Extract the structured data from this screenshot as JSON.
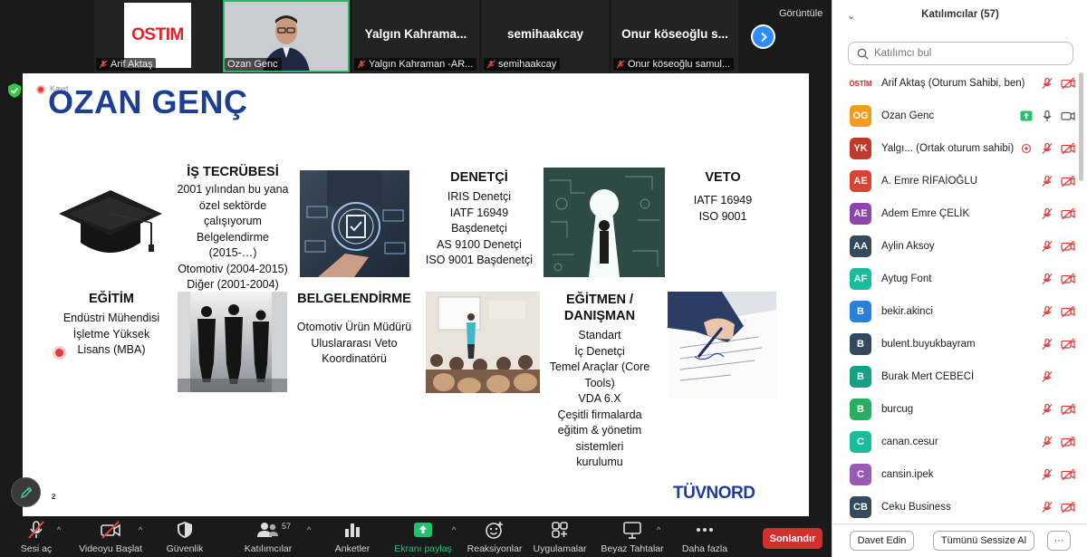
{
  "video_strip": {
    "tiles": [
      {
        "label": "Arif Aktaş",
        "logo_text": "OSTIM"
      },
      {
        "label": "Ozan Genc"
      },
      {
        "center_name": "Yalgın Kahrama...",
        "label": "Yalgın Kahraman -AR..."
      },
      {
        "center_name": "semihaakcay",
        "label": "semihaakcay"
      },
      {
        "center_name": "Onur köseoğlu s...",
        "label": "Onur köseoğlu samul..."
      }
    ],
    "view_label": "Görüntüle",
    "next_icon": "chevron-right-icon"
  },
  "slide": {
    "recording_label": "Kayıt",
    "title": "OZAN GENÇ",
    "sections": {
      "is_tecrubesi": {
        "heading": "İŞ TECRÜBESİ",
        "lines": [
          "2001 yılından bu yana",
          "özel sektörde",
          "çalışıyorum",
          "Belgelendirme",
          "(2015-…)",
          "Otomotiv  (2004-2015)",
          "Diğer (2001-2004)"
        ]
      },
      "denetci": {
        "heading": "DENETÇİ",
        "lines": [
          "IRIS Denetçi",
          "IATF 16949",
          "Başdenetçi",
          "AS 9100 Denetçi",
          "ISO 9001 Başdenetçi"
        ]
      },
      "veto": {
        "heading": "VETO",
        "lines": [
          "IATF 16949",
          "ISO 9001"
        ]
      },
      "egitim": {
        "heading": "EĞİTİM",
        "lines": [
          "Endüstri Mühendisi",
          "İşletme Yüksek",
          "Lisans (MBA)"
        ]
      },
      "belgelendirme": {
        "heading": "BELGELENDİRME",
        "lines": [
          "Otomotiv Ürün Müdürü",
          "Uluslararası Veto",
          "Koordinatörü"
        ]
      },
      "egitmen": {
        "heading_1": "EĞİTMEN /",
        "heading_2": "DANIŞMAN",
        "lines": [
          "Standart",
          "İç Denetçi",
          "Temel Araçlar (Core",
          "Tools)",
          "VDA 6.X",
          "Çeşitli firmalarda",
          "eğitim & yönetim",
          "sistemleri",
          "kurulumu"
        ]
      }
    },
    "page_number": "2",
    "logo_text": "TÜVNORD"
  },
  "toolbar": {
    "items": [
      {
        "label": "Sesi aç",
        "icon": "mic-muted-icon"
      },
      {
        "label": "Videoyu Başlat",
        "icon": "video-off-icon"
      },
      {
        "label": "Güvenlik",
        "icon": "shield-icon"
      },
      {
        "label": "Katılımcılar",
        "icon": "participants-icon",
        "count": "57"
      },
      {
        "label": "Anketler",
        "icon": "poll-icon"
      },
      {
        "label": "Ekranı paylaş",
        "icon": "share-screen-icon"
      },
      {
        "label": "Reaksiyonlar",
        "icon": "reaction-icon"
      },
      {
        "label": "Uygulamalar",
        "icon": "apps-icon"
      },
      {
        "label": "Beyaz Tahtalar",
        "icon": "whiteboard-icon"
      },
      {
        "label": "Daha fazla",
        "icon": "more-icon"
      }
    ],
    "end_label": "Sonlandır"
  },
  "panel": {
    "title": "Katılımcılar (57)",
    "search_placeholder": "Katılımcı bul",
    "participants": [
      {
        "initials": "",
        "name": "Arif Aktaş (Oturum Sahibi, ben)",
        "color": "",
        "logo": "ÖSTİM"
      },
      {
        "initials": "OG",
        "name": "Ozan Genc",
        "color": "#f29b1d"
      },
      {
        "initials": "YK",
        "name": "Yalgı...  (Ortak oturum sahibi)",
        "color": "#c0392b"
      },
      {
        "initials": "AE",
        "name": "A. Emre RİFAİOĞLU",
        "color": "#d84332"
      },
      {
        "initials": "AE",
        "name": "Adem Emre ÇELİK",
        "color": "#8e44ad"
      },
      {
        "initials": "AA",
        "name": "Aylin Aksoy",
        "color": "#34495e"
      },
      {
        "initials": "AF",
        "name": "Aytug Font",
        "color": "#1abc9c"
      },
      {
        "initials": "B",
        "name": "bekir.akinci",
        "color": "#2980d9"
      },
      {
        "initials": "B",
        "name": "bulent.buyukbayram",
        "color": "#34495e"
      },
      {
        "initials": "B",
        "name": "Burak Mert CEBECİ",
        "color": "#16a085"
      },
      {
        "initials": "B",
        "name": "burcug",
        "color": "#27ae60"
      },
      {
        "initials": "C",
        "name": "canan.cesur",
        "color": "#1abc9c"
      },
      {
        "initials": "C",
        "name": "cansin.ipek",
        "color": "#9b59b6"
      },
      {
        "initials": "CB",
        "name": "Ceku Business",
        "color": "#34495e"
      }
    ],
    "footer": {
      "invite_label": "Davet Edin",
      "mute_all_label": "Tümünü Sessize Al",
      "more_label": "···"
    }
  }
}
